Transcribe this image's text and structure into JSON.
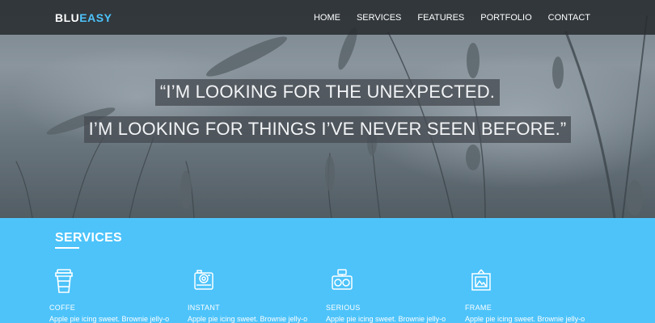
{
  "brand": {
    "part1": "BLU",
    "part2": "EASY"
  },
  "nav": {
    "items": [
      {
        "label": "HOME"
      },
      {
        "label": "SERVICES"
      },
      {
        "label": "FEATURES"
      },
      {
        "label": "PORTFOLIO"
      },
      {
        "label": "CONTACT"
      }
    ]
  },
  "hero": {
    "quote_line1": "“I’M LOOKING FOR THE UNEXPECTED.",
    "quote_line2": "I’M LOOKING FOR THINGS I’VE NEVER SEEN BEFORE.”"
  },
  "services": {
    "title": "SERVICES",
    "items": [
      {
        "icon": "cup-icon",
        "name": "COFFE",
        "desc": "Apple pie icing sweet. Brownie jelly-o"
      },
      {
        "icon": "instant-camera-icon",
        "name": "INSTANT",
        "desc": "Apple pie icing sweet. Brownie jelly-o"
      },
      {
        "icon": "camera-icon",
        "name": "SERIOUS",
        "desc": "Apple pie icing sweet. Brownie jelly-o"
      },
      {
        "icon": "picture-frame-icon",
        "name": "FRAME",
        "desc": "Apple pie icing sweet. Brownie jelly-o"
      }
    ]
  },
  "colors": {
    "accent": "#4dc3fa",
    "navbar": "#2c3034"
  }
}
